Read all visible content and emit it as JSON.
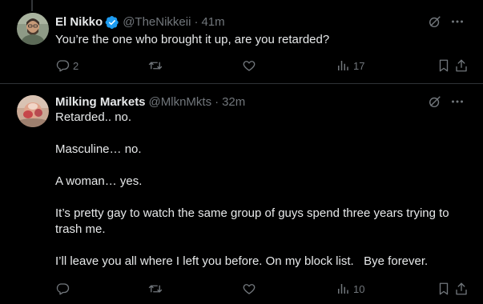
{
  "tweets": [
    {
      "name": "El Nikko",
      "verified": true,
      "handle": "@TheNikkeii",
      "separator": "·",
      "time": "41m",
      "paragraphs": [
        "You’re the one who brought it up, are you retarded?"
      ],
      "stats": {
        "replies": "2",
        "retweets": "",
        "likes": "",
        "views": "17"
      }
    },
    {
      "name": "Milking Markets",
      "verified": false,
      "handle": "@MlknMkts",
      "separator": "·",
      "time": "32m",
      "paragraphs": [
        "Retarded.. no.",
        "Masculine… no.",
        "A woman… yes.",
        "It’s pretty gay to watch the same group of guys spend three years trying to trash me.",
        "I’ll leave you all where I left you before. On my block list.   Bye forever."
      ],
      "stats": {
        "replies": "",
        "retweets": "",
        "likes": "",
        "views": "10"
      }
    }
  ],
  "icons": {
    "verified": "verified-badge-icon",
    "grok": "grok-icon",
    "more": "more-icon",
    "reply": "reply-icon",
    "retweet": "retweet-icon",
    "like": "like-icon",
    "views": "views-icon",
    "bookmark": "bookmark-icon",
    "share": "share-icon"
  },
  "colors": {
    "background": "#000000",
    "text": "#e7e9ea",
    "muted": "#71767b",
    "verified": "#1d9bf0",
    "divider": "#2f3336"
  }
}
